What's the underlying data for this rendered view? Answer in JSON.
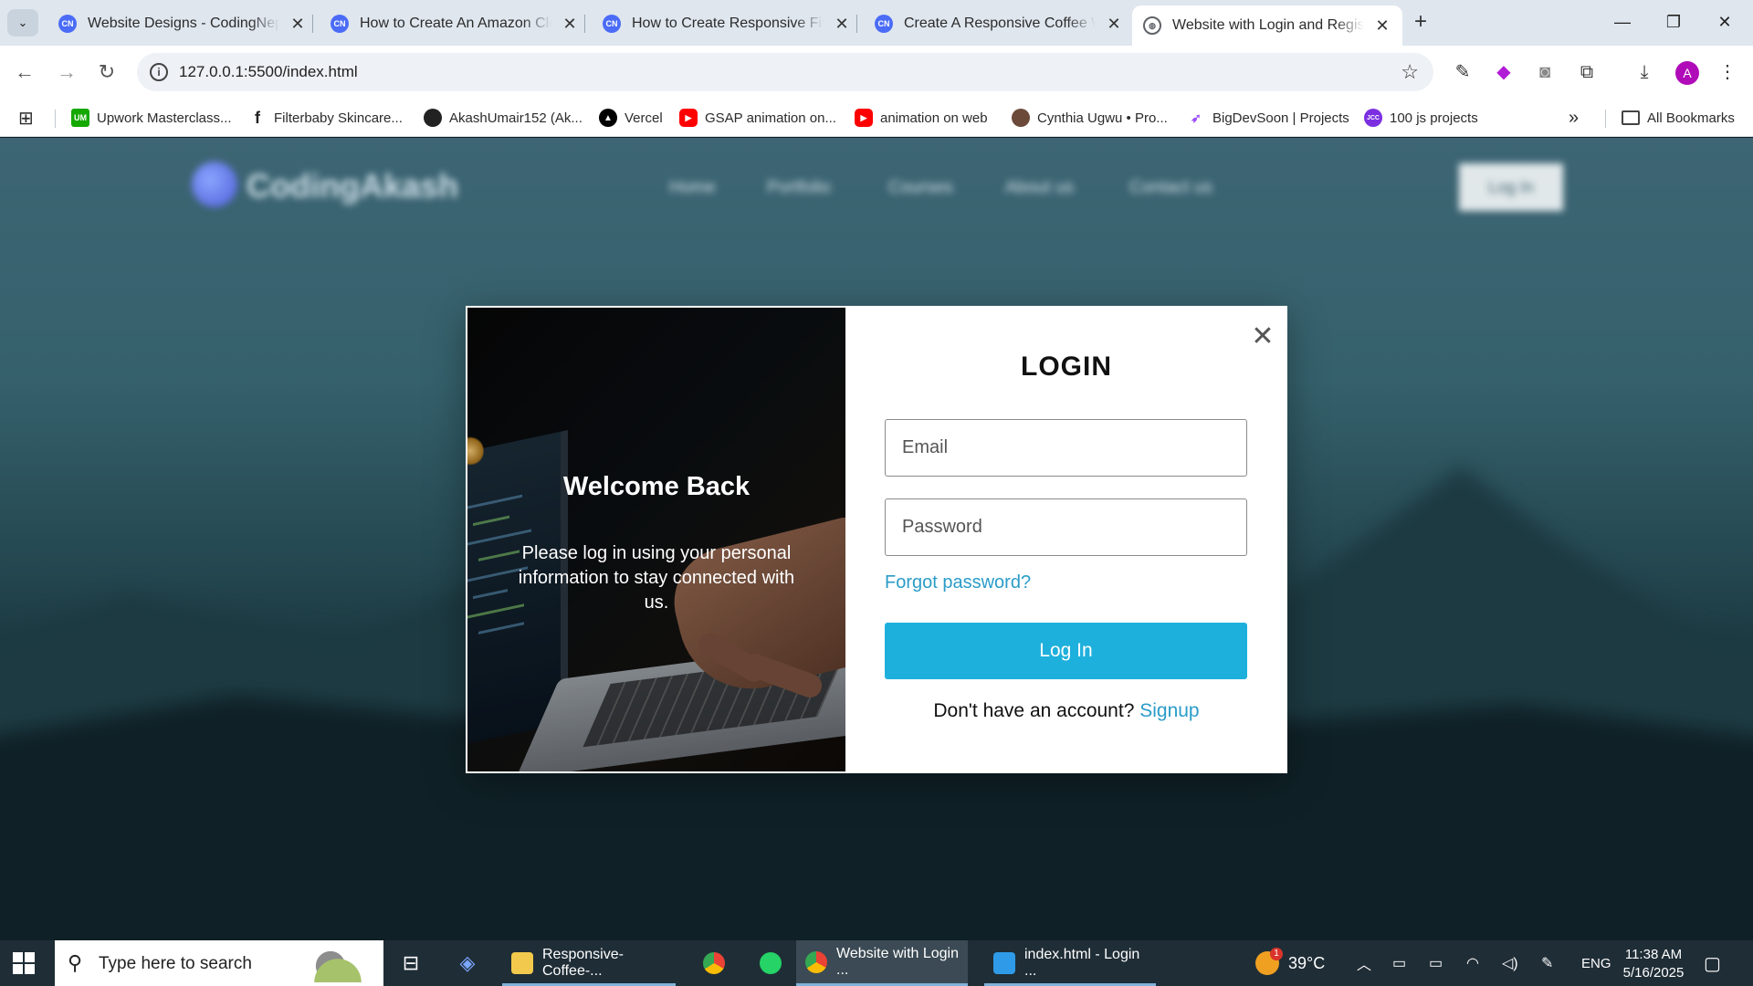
{
  "browser": {
    "tabs": [
      {
        "title": "Website Designs - CodingNepal",
        "favicon": "codingnepal-icon",
        "active": false
      },
      {
        "title": "How to Create An Amazon Clone",
        "favicon": "codingnepal-icon",
        "active": false
      },
      {
        "title": "How to Create Responsive Fiverr",
        "favicon": "codingnepal-icon",
        "active": false
      },
      {
        "title": "Create A Responsive Coffee Website",
        "favicon": "codingnepal-icon",
        "active": false
      },
      {
        "title": "Website with Login and Registration",
        "favicon": "globe-icon",
        "active": true
      }
    ],
    "favicon_text": "CN",
    "url": "127.0.0.1:5500/index.html",
    "bookmarks": [
      {
        "label": "Upwork Masterclass...",
        "icon": "upwork-icon",
        "icon_text": "UM",
        "color": "#14a800"
      },
      {
        "label": "Filterbaby Skincare...",
        "icon": "filterbaby-icon",
        "icon_text": "f",
        "color": "#222222"
      },
      {
        "label": "AkashUmair152 (Ak...",
        "icon": "github-icon",
        "icon_text": "",
        "color": "#222222"
      },
      {
        "label": "Vercel",
        "icon": "vercel-icon",
        "icon_text": "▲",
        "color": "#000000"
      },
      {
        "label": "GSAP animation on...",
        "icon": "youtube-icon",
        "icon_text": "▶",
        "color": "#ff0000"
      },
      {
        "label": "animation on web",
        "icon": "youtube-icon",
        "icon_text": "▶",
        "color": "#ff0000"
      },
      {
        "label": "Cynthia Ugwu • Pro...",
        "icon": "profile-icon",
        "icon_text": "",
        "color": "#6b4a3a"
      },
      {
        "label": "BigDevSoon | Projects",
        "icon": "rocket-icon",
        "icon_text": "🚀",
        "color": "#ffffff"
      },
      {
        "label": "100 js projects",
        "icon": "jcc-icon",
        "icon_text": "JCC",
        "color": "#7b2fe0"
      }
    ],
    "all_bookmarks": "All Bookmarks",
    "profile_initial": "A"
  },
  "site": {
    "logo": "CodingAkash",
    "nav": [
      "Home",
      "Portfolio",
      "Courses",
      "About us",
      "Contact us"
    ],
    "login_button": "Log In"
  },
  "modal": {
    "welcome_title": "Welcome Back",
    "welcome_text": "Please log in using your personal information to stay connected with us.",
    "title": "LOGIN",
    "email_placeholder": "Email",
    "password_placeholder": "Password",
    "forgot": "Forgot password?",
    "submit": "Log In",
    "signup_prompt": "Don't have an account?",
    "signup_link": "Signup",
    "accent_color": "#1eb0dc"
  },
  "taskbar": {
    "search_placeholder": "Type here to search",
    "apps": [
      {
        "label": "Responsive-Coffee-...",
        "icon": "folder-icon"
      },
      {
        "label": "",
        "icon": "chrome-icon"
      },
      {
        "label": "",
        "icon": "whatsapp-icon"
      },
      {
        "label": "Website with Login ...",
        "icon": "chrome-icon"
      },
      {
        "label": "index.html - Login ...",
        "icon": "vscode-icon"
      }
    ],
    "weather": "39°C",
    "weather_badge": "1",
    "language": "ENG",
    "time": "11:38 AM",
    "date": "5/16/2025"
  }
}
